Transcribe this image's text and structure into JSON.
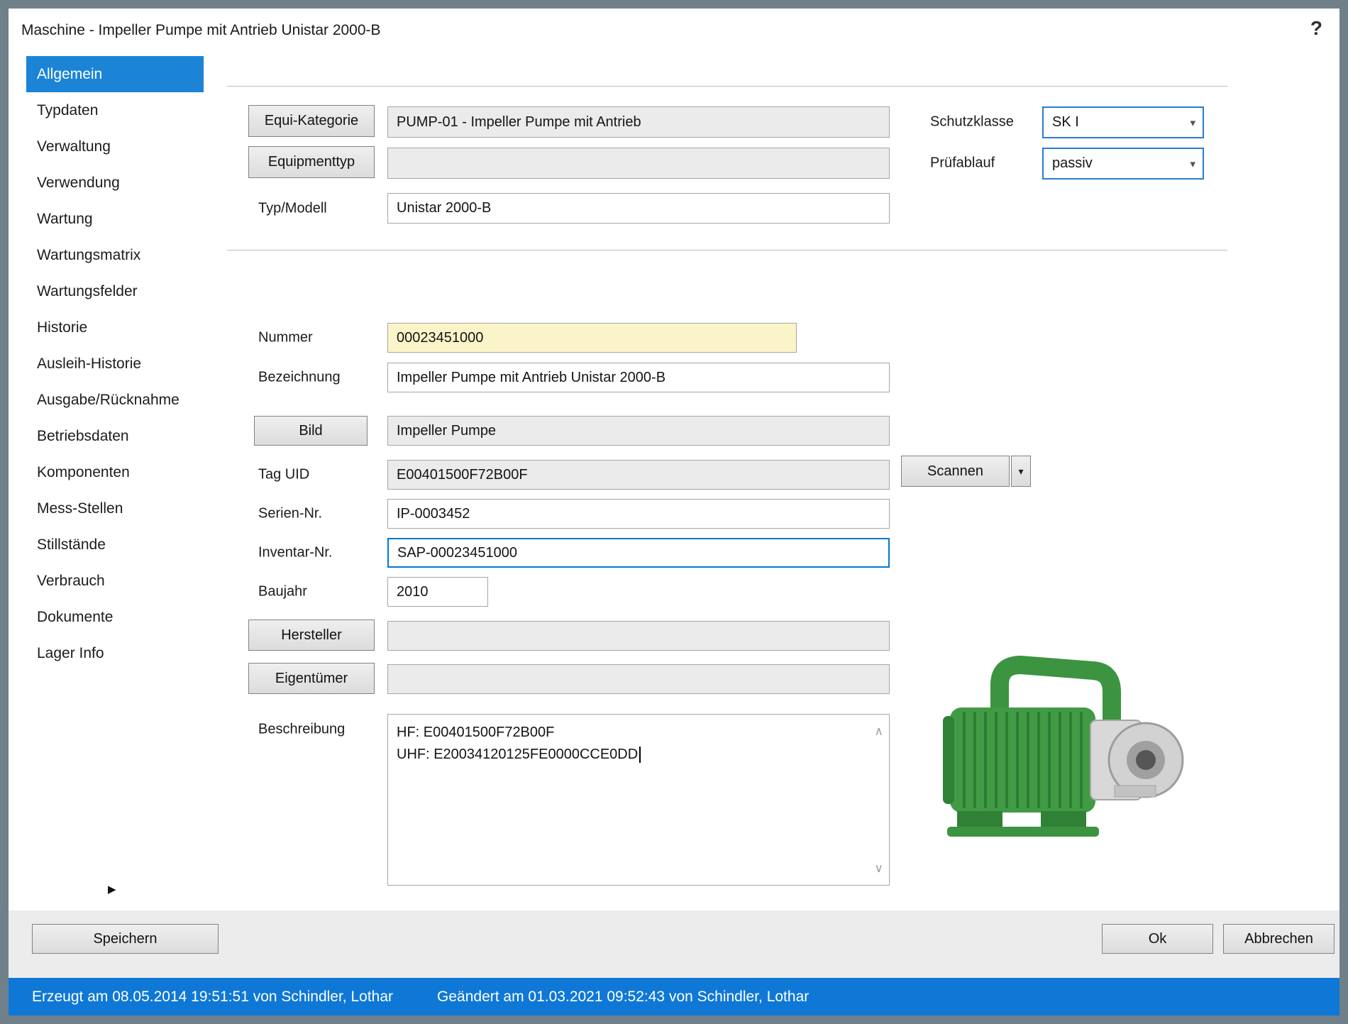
{
  "window": {
    "title": "Maschine - Impeller Pumpe mit Antrieb Unistar 2000-B"
  },
  "icons": {
    "help": "?",
    "chevron_down": "▾",
    "scroll_up": "∧",
    "scroll_down": "∨",
    "sidebar_more_arrow": "▶"
  },
  "sidebar": {
    "selected_index": 0,
    "items": [
      "Allgemein",
      "Typdaten",
      "Verwaltung",
      "Verwendung",
      "Wartung",
      "Wartungsmatrix",
      "Wartungsfelder",
      "Historie",
      "Ausleih-Historie",
      "Ausgabe/Rücknahme",
      "Betriebsdaten",
      "Komponenten",
      "Mess-Stellen",
      "Stillstände",
      "Verbrauch",
      "Dokumente",
      "Lager Info"
    ]
  },
  "form": {
    "equi_kategorie": {
      "button_label": "Equi-Kategorie",
      "value": "PUMP-01 - Impeller Pumpe mit Antrieb"
    },
    "equipmenttyp": {
      "button_label": "Equipmenttyp",
      "value": ""
    },
    "typ_modell": {
      "label": "Typ/Modell",
      "value": "Unistar 2000-B"
    },
    "schutzklasse": {
      "label": "Schutzklasse",
      "value": "SK I"
    },
    "pruefablauf": {
      "label": "Prüfablauf",
      "value": "passiv"
    },
    "nummer": {
      "label": "Nummer",
      "value": "00023451000"
    },
    "bezeichnung": {
      "label": "Bezeichnung",
      "value": "Impeller Pumpe mit Antrieb Unistar 2000-B"
    },
    "bild": {
      "button_label": "Bild",
      "value": "Impeller Pumpe"
    },
    "tag_uid": {
      "label": "Tag UID",
      "value": "E00401500F72B00F"
    },
    "scannen": {
      "button_label": "Scannen"
    },
    "serien_nr": {
      "label": "Serien-Nr.",
      "value": "IP-0003452"
    },
    "inventar_nr": {
      "label": "Inventar-Nr.",
      "value": "SAP-00023451000"
    },
    "baujahr": {
      "label": "Baujahr",
      "value": "2010"
    },
    "hersteller": {
      "button_label": "Hersteller",
      "value": ""
    },
    "eigentuemer": {
      "button_label": "Eigentümer",
      "value": ""
    },
    "beschreibung": {
      "label": "Beschreibung",
      "lines": [
        "HF: E00401500F72B00F",
        "UHF: E20034120125FE0000CCE0DD"
      ]
    }
  },
  "footer": {
    "speichern_label": "Speichern",
    "ok_label": "Ok",
    "abbrechen_label": "Abbrechen"
  },
  "statusbar": {
    "created_text": "Erzeugt am 08.05.2014 19:51:51 von Schindler, Lothar",
    "modified_text": "Geändert am 01.03.2021 09:52:43 von Schindler, Lothar"
  },
  "colors": {
    "accent_blue": "#1b84d7",
    "statusbar_blue": "#0f78d7",
    "focus_blue": "#0078d7",
    "field_yellow": "#fbf4c9",
    "frame_gray": "#70808a"
  }
}
